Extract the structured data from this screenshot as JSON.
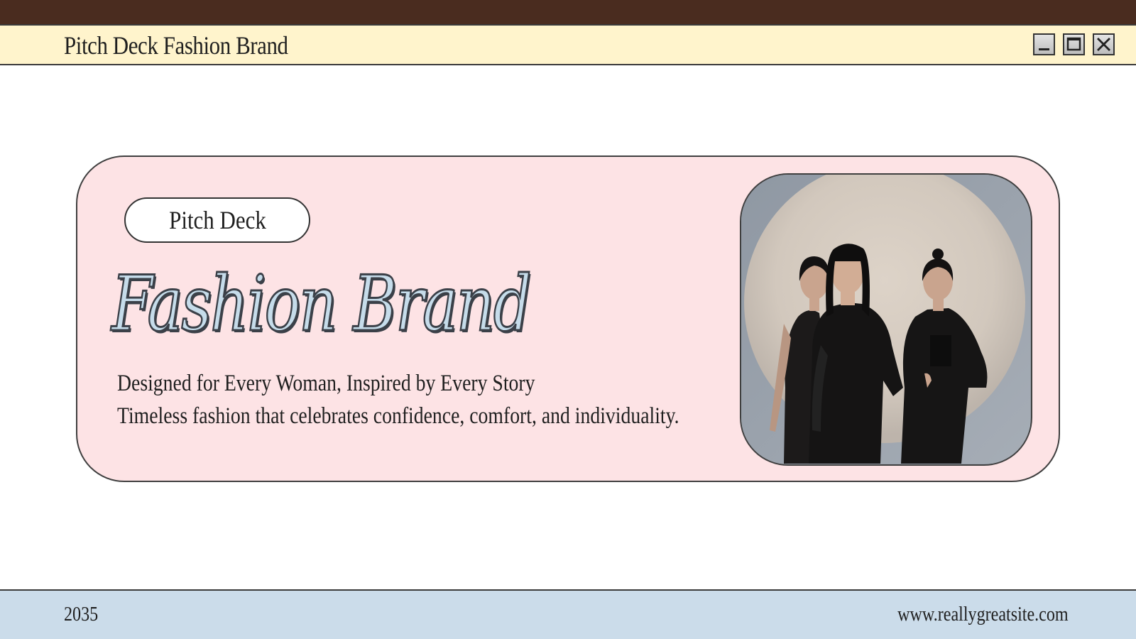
{
  "window": {
    "title": "Pitch Deck Fashion Brand",
    "controls": {
      "minimize_icon": "minimize-icon",
      "maximize_icon": "maximize-icon",
      "close_icon": "close-icon"
    }
  },
  "hero": {
    "badge": "Pitch Deck",
    "title": "Fashion Brand",
    "tagline": "Designed for Every Woman, Inspired by Every Story",
    "description": "Timeless fashion that celebrates confidence, comfort, and individuality."
  },
  "footer": {
    "year": "2035",
    "website": "www.reallygreatsite.com"
  },
  "colors": {
    "top_strip": "#4a2c1f",
    "title_bar": "#fff4cc",
    "card": "#fde3e5",
    "title_fill": "#c6dcea",
    "footer": "#cbdcea"
  }
}
